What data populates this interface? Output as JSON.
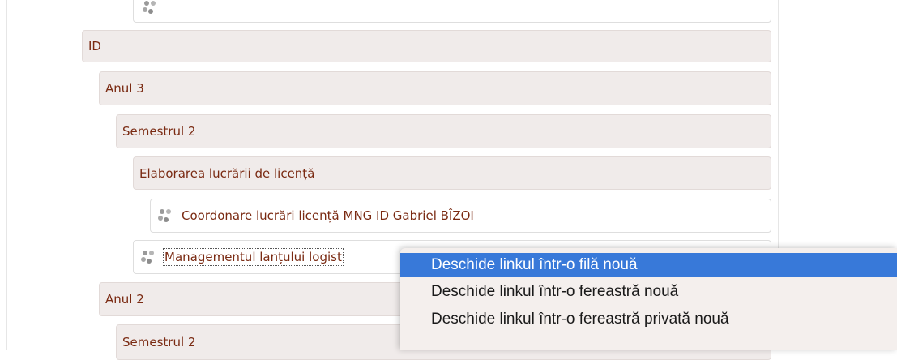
{
  "tree": {
    "top_partial": {
      "label": ""
    },
    "id_category": {
      "label": "ID"
    },
    "year3": {
      "label": "Anul 3"
    },
    "semester2_a": {
      "label": "Semestrul 2"
    },
    "thesis": {
      "label": "Elaborarea lucrării de licență"
    },
    "course_coord": {
      "label": "Coordonare lucrări licență MNG ID Gabriel BÎZOI"
    },
    "course_logistics": {
      "label": "Managementul lanțului logist"
    },
    "year2": {
      "label": "Anul 2"
    },
    "semester2_b": {
      "label": "Semestrul 2"
    }
  },
  "context_menu": {
    "items": [
      {
        "label": "Deschide linkul într-o filă nouă",
        "active": true
      },
      {
        "label": "Deschide linkul într-o fereastră nouă",
        "active": false
      },
      {
        "label": "Deschide linkul într-o fereastră privată nouă",
        "active": false
      }
    ]
  },
  "colors": {
    "link_text": "#7a2a12",
    "category_bg": "#f0ebea",
    "menu_highlight": "#3879d9",
    "menu_bg": "#f4efed"
  },
  "icons": {
    "course": "course-icon"
  }
}
